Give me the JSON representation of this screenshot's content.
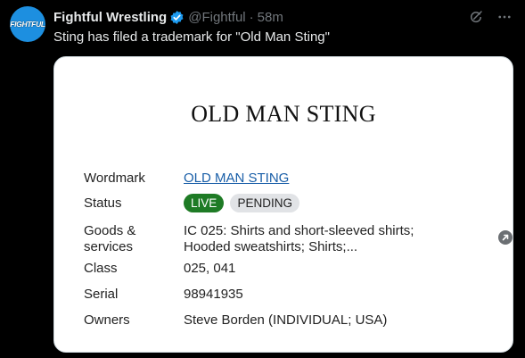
{
  "author": {
    "avatar_text": "FIGHTFUL",
    "name": "Fightful Wrestling",
    "handle": "@Fightful",
    "separator": "·",
    "time": "58m"
  },
  "tweet": {
    "text": "Sting has filed a trademark for \"Old Man Sting\""
  },
  "card": {
    "title": "OLD MAN STING",
    "rows": [
      {
        "label": "Wordmark",
        "value": "OLD MAN STING"
      },
      {
        "label": "Status",
        "badges": [
          "LIVE",
          "PENDING"
        ]
      },
      {
        "label": "Goods & services",
        "value": "IC 025: Shirts and short-sleeved shirts; Hooded sweatshirts; Shirts;..."
      },
      {
        "label": "Class",
        "value": "025, 041"
      },
      {
        "label": "Serial",
        "value": "98941935"
      },
      {
        "label": "Owners",
        "value": "Steve Borden (INDIVIDUAL; USA)"
      }
    ]
  },
  "colors": {
    "accent": "#1d9bf0",
    "live": "#1e7b25",
    "pending": "#e1e3e6",
    "link": "#1a5fa8"
  },
  "icons": [
    "verified-badge-icon",
    "grok-icon",
    "more-icon",
    "expand-arrow-icon"
  ]
}
